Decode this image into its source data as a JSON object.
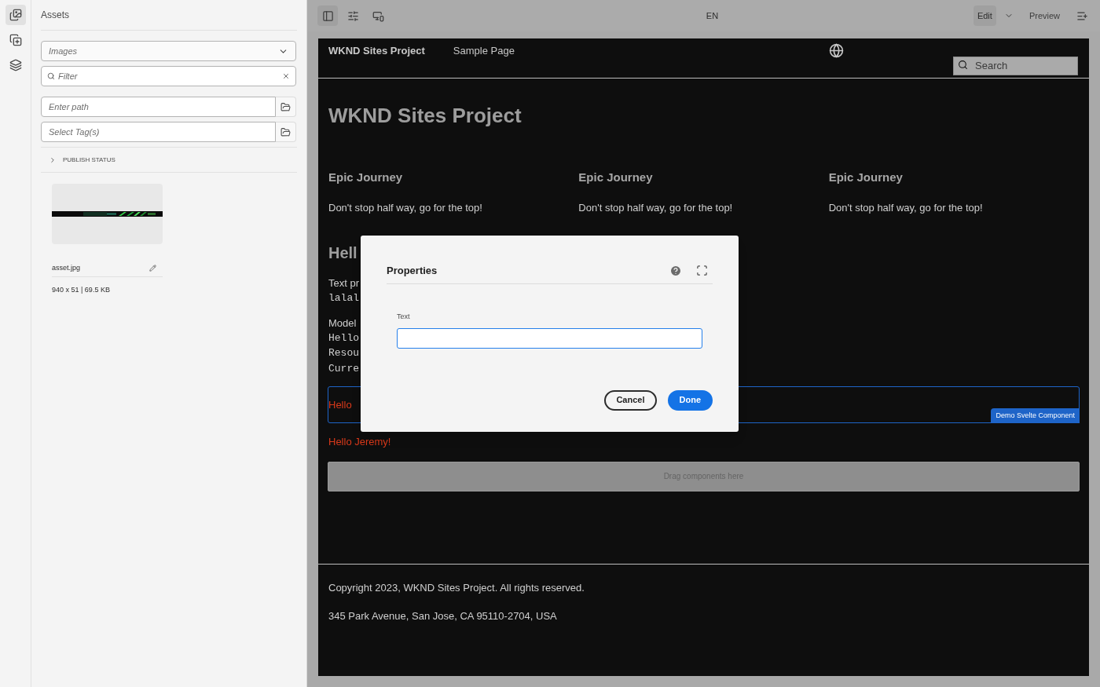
{
  "rail": [
    {
      "kind": "assets",
      "selected": true
    },
    {
      "kind": "components",
      "selected": false
    },
    {
      "kind": "layers",
      "selected": false
    }
  ],
  "sidebar": {
    "title": "Assets",
    "type_select": {
      "value": "Images"
    },
    "filter": {
      "placeholder": "Filter"
    },
    "path": {
      "placeholder": "Enter path"
    },
    "tags": {
      "placeholder": "Select Tag(s)"
    },
    "publish_status": {
      "label": "PUBLISH STATUS",
      "expanded": false
    },
    "asset": {
      "kind": "picture",
      "name": "asset.jpg",
      "info": "940 x 51 | 69.5 KB"
    }
  },
  "toolbar": {
    "language": "EN",
    "mode": "Edit",
    "preview": "Preview"
  },
  "page": {
    "brand": "WKND Sites Project",
    "nav_link": "Sample Page",
    "search": {
      "placeholder": "Search"
    },
    "title": "WKND Sites Project",
    "cards": [
      {
        "title": "Epic Journey",
        "text": "Don't stop half way, go for the top!"
      },
      {
        "title": "Epic Journey",
        "text": "Don't stop half way, go for the top!"
      },
      {
        "title": "Epic Journey",
        "text": "Don't stop half way, go for the top!"
      }
    ],
    "section_heading": "Hell",
    "lines": [
      {
        "kind": "text",
        "text": "Text pr"
      },
      {
        "kind": "code",
        "text": "lalal"
      },
      {
        "kind": "gap"
      },
      {
        "kind": "text",
        "text": "Model"
      },
      {
        "kind": "code",
        "text": "Hello"
      },
      {
        "kind": "code",
        "text": "Resou"
      },
      {
        "kind": "code",
        "text": "Curre"
      }
    ],
    "component": {
      "text": "Hello",
      "label": "Demo Svelte Component",
      "selected": true
    },
    "greeting": "Hello Jeremy!",
    "dropzone": "Drag components here",
    "footer": [
      "Copyright 2023, WKND Sites Project. All rights reserved.",
      "345 Park Avenue, San Jose, CA 95110-2704, USA"
    ]
  },
  "dialog": {
    "title": "Properties",
    "field_label": "Text",
    "buttons": [
      {
        "kind": "secondary",
        "label": "Cancel"
      },
      {
        "kind": "primary",
        "label": "Done"
      }
    ]
  }
}
